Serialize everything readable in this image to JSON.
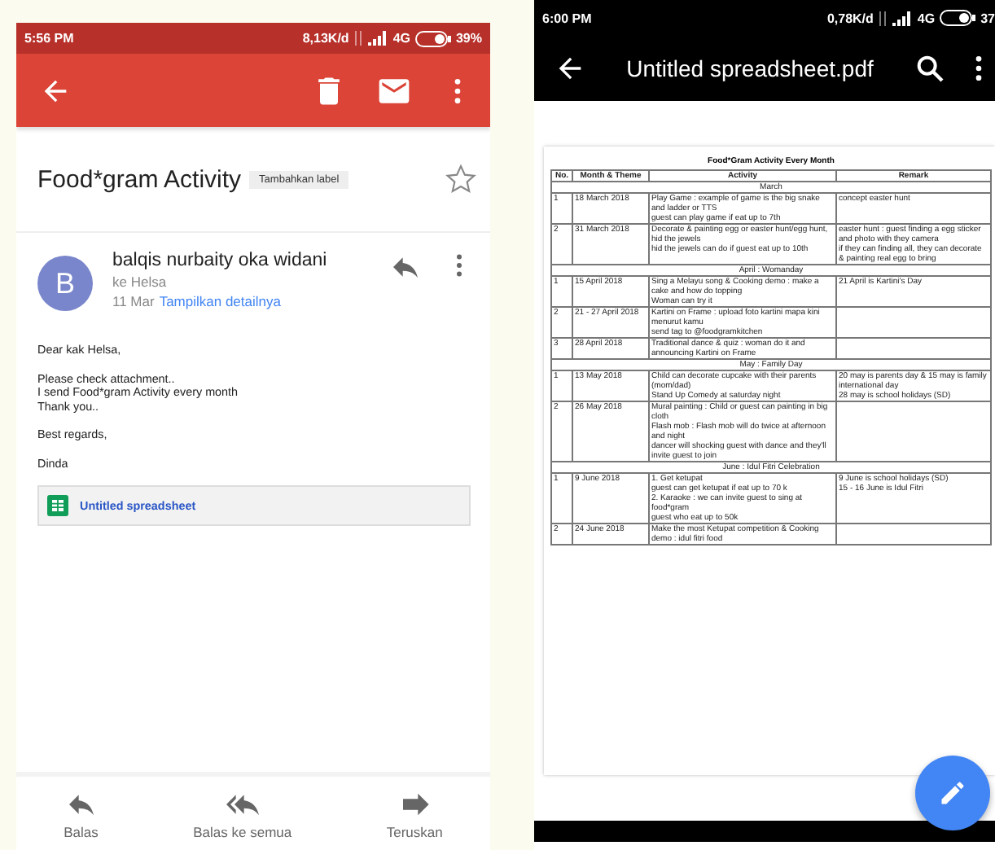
{
  "email_screen": {
    "status_bar": {
      "time": "5:56 PM",
      "speed": "8,13K/d",
      "network": "4G",
      "battery": "39%"
    },
    "subject": "Food*gram Activity",
    "label_chip": "Tambahkan label",
    "starred": false,
    "sender": {
      "initial": "B",
      "name": "balqis nurbaity oka widani",
      "recipient": "ke Helsa",
      "date": "11 Mar",
      "details_link": "Tampilkan detailnya"
    },
    "body": [
      [
        "Dear kak Helsa,"
      ],
      [
        "Please check attachment..",
        "I send Food*gram Activity every month",
        "Thank you.."
      ],
      [
        "Best regards,"
      ],
      [
        "Dinda"
      ]
    ],
    "attachment": "Untitled spreadsheet",
    "actions": [
      {
        "kind": "reply",
        "label": "Balas"
      },
      {
        "kind": "reply-all",
        "label": "Balas ke semua"
      },
      {
        "kind": "forward",
        "label": "Teruskan"
      }
    ]
  },
  "pdf_screen": {
    "status_bar": {
      "time": "6:00 PM",
      "speed": "0,78K/d",
      "network": "4G",
      "battery": "37"
    },
    "title": "Untitled spreadsheet.pdf",
    "document": {
      "title": "Food*Gram Activity Every Month",
      "columns": [
        "No.",
        "Month & Theme",
        "Activity",
        "Remark"
      ],
      "sections": [
        {
          "heading": "March",
          "rows": [
            {
              "no": "1",
              "date": "18 March 2018",
              "activity": [
                "Play Game : example of game is the big snake and ladder or TTS",
                "guest can play game if eat up to 7th"
              ],
              "remark": [
                "concept easter hunt"
              ]
            },
            {
              "no": "2",
              "date": "31 March 2018",
              "activity": [
                "Decorate & painting egg or easter hunt/egg hunt, hid the jewels",
                "hid the jewels can do if guest eat up to 10th"
              ],
              "remark": [
                "easter hunt : guest finding a egg sticker and photo with they camera",
                "if they can finding all, they can decorate & painting real egg to bring"
              ]
            }
          ]
        },
        {
          "heading": "April : Womanday",
          "rows": [
            {
              "no": "1",
              "date": "15 April 2018",
              "activity": [
                "Sing a Melayu song & Cooking demo : make a cake and how do topping",
                "Woman can try it"
              ],
              "remark": [
                "21 April is Kartini's Day"
              ]
            },
            {
              "no": "2",
              "date": "21 - 27 April 2018",
              "activity": [
                "Kartini on Frame : upload foto kartini mapa kini menurut kamu",
                "send tag to @foodgramkitchen"
              ],
              "remark": []
            },
            {
              "no": "3",
              "date": "28 April 2018",
              "activity": [
                "Traditional dance & quiz : woman do it and announcing Kartini on Frame"
              ],
              "remark": []
            }
          ]
        },
        {
          "heading": "May : Family Day",
          "rows": [
            {
              "no": "1",
              "date": "13 May 2018",
              "activity": [
                "Child can decorate cupcake with their parents (mom/dad)",
                "Stand Up Comedy at saturday night"
              ],
              "remark": [
                "20 may is parents day & 15 may is family international day",
                "28 may is school holidays (SD)"
              ]
            },
            {
              "no": "2",
              "date": "26 May 2018",
              "activity": [
                "Mural painting : Child or guest can painting in big cloth",
                "Flash mob : Flash mob will do twice at afternoon and night",
                "dancer will shocking guest with dance and they'll invite guest to join"
              ],
              "remark": []
            }
          ]
        },
        {
          "heading": "June : Idul Fitri Celebration",
          "rows": [
            {
              "no": "1",
              "date": "9 June 2018",
              "activity": [
                "1. Get ketupat",
                "guest can get ketupat if eat up to 70 k",
                "2. Karaoke : we can invite guest to sing at food*gram",
                "guest who eat up to 50k"
              ],
              "remark": [
                "9 June is school holidays (SD)",
                "15 - 16 June is Idul Fitri"
              ]
            },
            {
              "no": "2",
              "date": "24 June 2018",
              "activity": [
                "Make the most Ketupat competition & Cooking demo : idul fitri food"
              ],
              "remark": []
            }
          ]
        }
      ]
    }
  }
}
